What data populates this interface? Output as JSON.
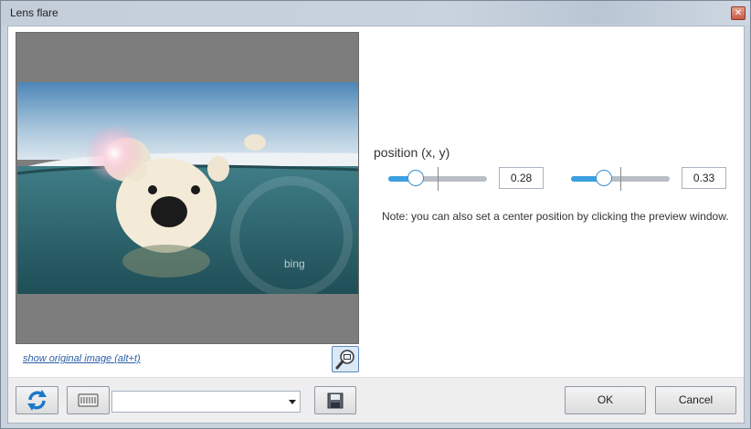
{
  "window": {
    "title": "Lens flare"
  },
  "preview": {
    "show_original_label": "show original image (alt+t)",
    "watermark": "bing"
  },
  "position": {
    "label": "position (x, y)",
    "x": {
      "value": 0.28,
      "display": "0.28"
    },
    "y": {
      "value": 0.33,
      "display": "0.33"
    }
  },
  "note": "Note: you can also set a center position by clicking the preview window.",
  "footer": {
    "preset_selected": "",
    "ok_label": "OK",
    "cancel_label": "Cancel"
  },
  "icons": {
    "close": "close-icon",
    "zoom": "magnifier-icon",
    "refresh": "refresh-icon",
    "keyboard": "keyboard-icon",
    "save": "save-icon",
    "dropdown": "chevron-down-icon"
  },
  "colors": {
    "accent": "#3aa0e0",
    "slider_track": "#b9bec6"
  }
}
